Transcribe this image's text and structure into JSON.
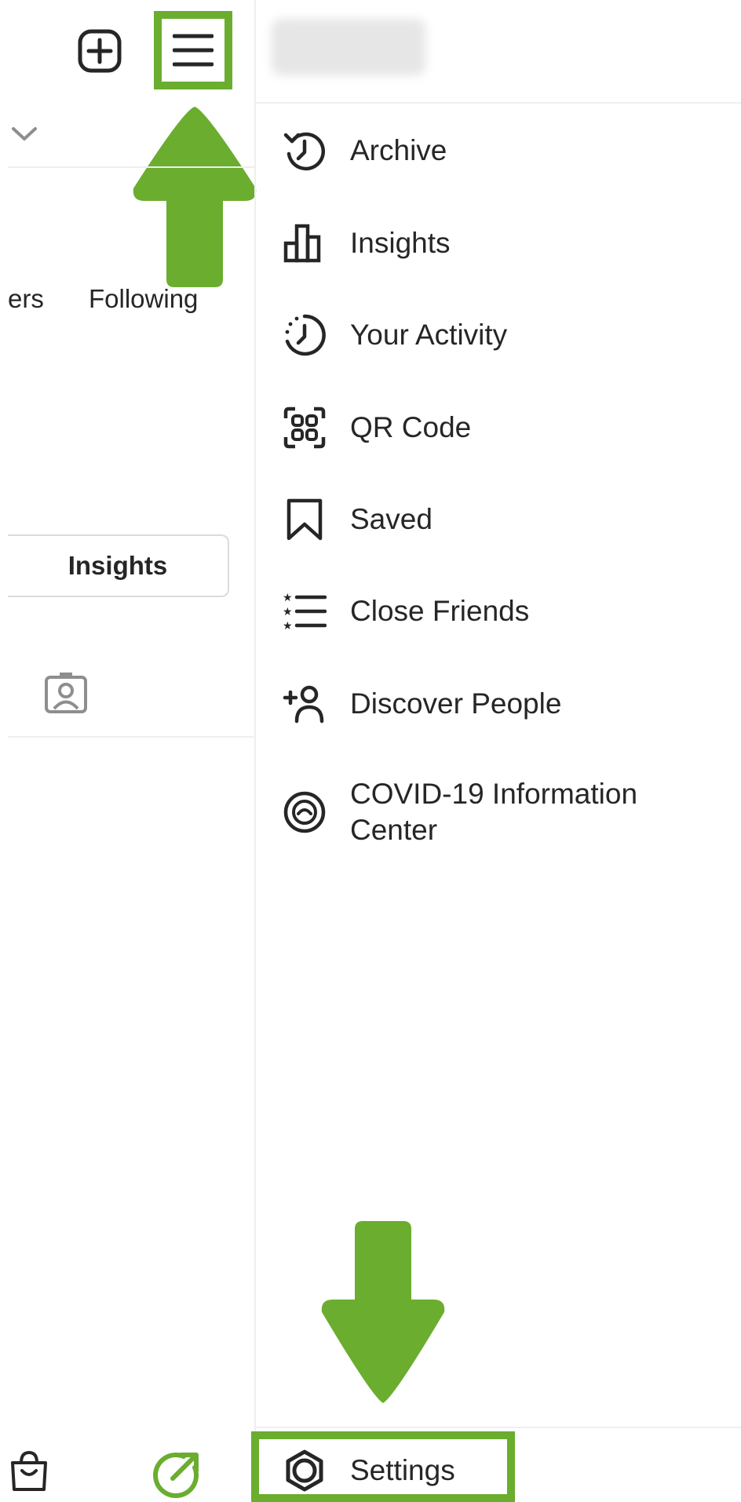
{
  "left_pane": {
    "followers_partial": "ers",
    "following_label": "Following",
    "insights_button_label": "Insights"
  },
  "menu": {
    "items": [
      {
        "label": "Archive",
        "icon": "archive-icon"
      },
      {
        "label": "Insights",
        "icon": "insights-icon"
      },
      {
        "label": "Your Activity",
        "icon": "activity-icon"
      },
      {
        "label": "QR Code",
        "icon": "qr-code-icon"
      },
      {
        "label": "Saved",
        "icon": "bookmark-icon"
      },
      {
        "label": "Close Friends",
        "icon": "close-friends-icon"
      },
      {
        "label": "Discover People",
        "icon": "discover-people-icon"
      },
      {
        "label": "COVID-19 Information\nCenter",
        "icon": "covid-info-icon"
      }
    ],
    "settings_label": "Settings"
  },
  "colors": {
    "highlight": "#6aad2f",
    "text": "#262626",
    "divider": "#efefef"
  }
}
